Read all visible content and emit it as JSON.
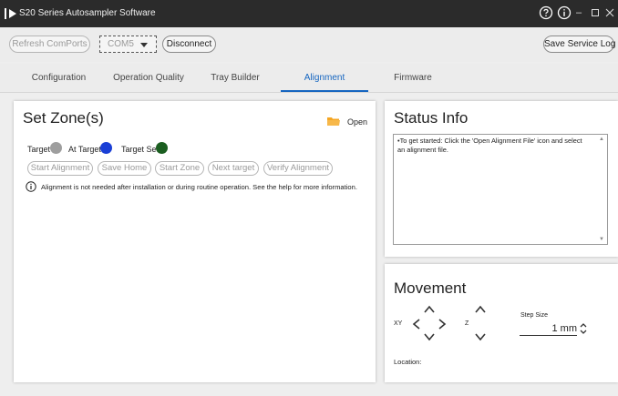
{
  "app": {
    "title": "S20 Series Autosampler Software",
    "icons": [
      "app-logo-icon",
      "help-icon",
      "info-icon",
      "minimize-icon",
      "maximize-icon",
      "close-icon"
    ]
  },
  "toolbar": {
    "refresh_label": "Refresh ComPorts",
    "com_port_value": "COM5",
    "disconnect_label": "Disconnect",
    "save_log_label": "Save Service Log"
  },
  "tabs": [
    {
      "label": "Configuration"
    },
    {
      "label": "Operation Quality"
    },
    {
      "label": "Tray Builder"
    },
    {
      "label": "Alignment",
      "active": true
    },
    {
      "label": "Firmware"
    }
  ],
  "set_zone": {
    "title": "Set Zone(s)",
    "open_label": "Open",
    "legend": {
      "target_label": "Target",
      "target_color": "#9e9e9e",
      "at_target_label": "At Target",
      "at_target_color": "#1a3fd6",
      "target_set_label": "Target Set",
      "target_set_color": "#1b5e20"
    },
    "buttons": {
      "start_alignment": "Start Alignment",
      "save_home": "Save Home",
      "start_zone": "Start Zone",
      "next_target": "Next target",
      "verify_alignment": "Verify Alignment"
    },
    "info_text": "Alignment is not needed after installation or during routine operation. See the help for more information."
  },
  "status_info": {
    "title": "Status Info",
    "text": "•To get started: Click the 'Open Alignment File' icon and select an alignment file."
  },
  "movement": {
    "title": "Movement",
    "xy_label": "XY",
    "z_label": "Z",
    "step_size_label": "Step Size",
    "step_size_value": "1",
    "step_size_unit": "mm",
    "location_label": "Location:"
  }
}
